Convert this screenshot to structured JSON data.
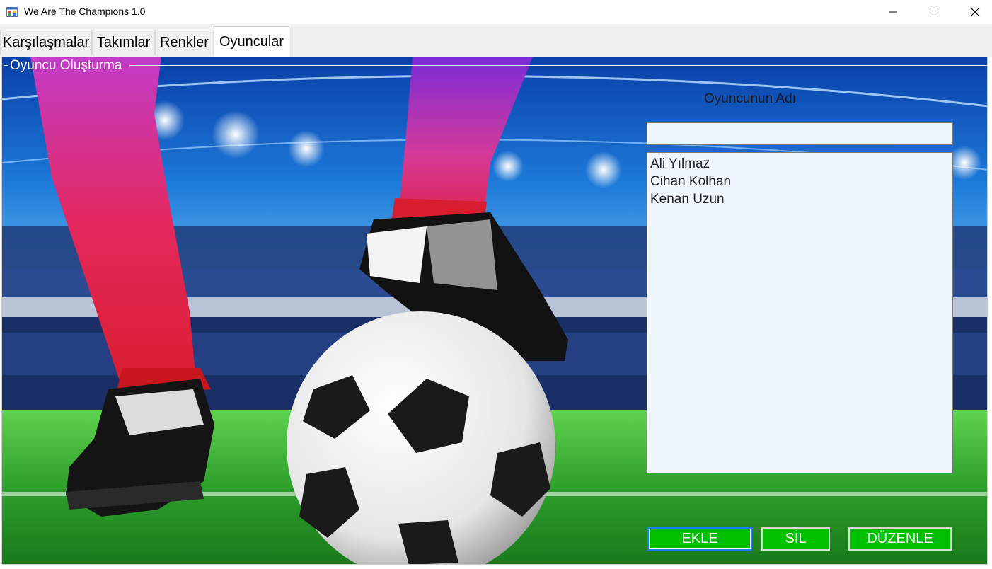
{
  "window": {
    "title": "We Are The Champions 1.0",
    "icons": {
      "app": "app-icon",
      "minimize": "minimize-icon",
      "maximize": "maximize-icon",
      "close": "close-icon"
    }
  },
  "tabs": [
    {
      "label": "Karşılaşmalar",
      "active": false
    },
    {
      "label": "Takımlar",
      "active": false
    },
    {
      "label": "Renkler",
      "active": false
    },
    {
      "label": "Oyuncular",
      "active": true
    }
  ],
  "groupbox": {
    "caption": "Oyuncu Oluşturma"
  },
  "form": {
    "name_label": "Oyuncunun Adı",
    "name_value": "",
    "players": [
      "Ali Yılmaz",
      "Cihan Kolhan",
      "Kenan Uzun"
    ]
  },
  "buttons": {
    "add": "EKLE",
    "delete": "SİL",
    "edit": "DÜZENLE"
  },
  "colors": {
    "button_bg": "#00c000",
    "button_text": "#ffffff",
    "list_bg": "#f0f6fd",
    "focus_border": "#1b7fe3"
  }
}
